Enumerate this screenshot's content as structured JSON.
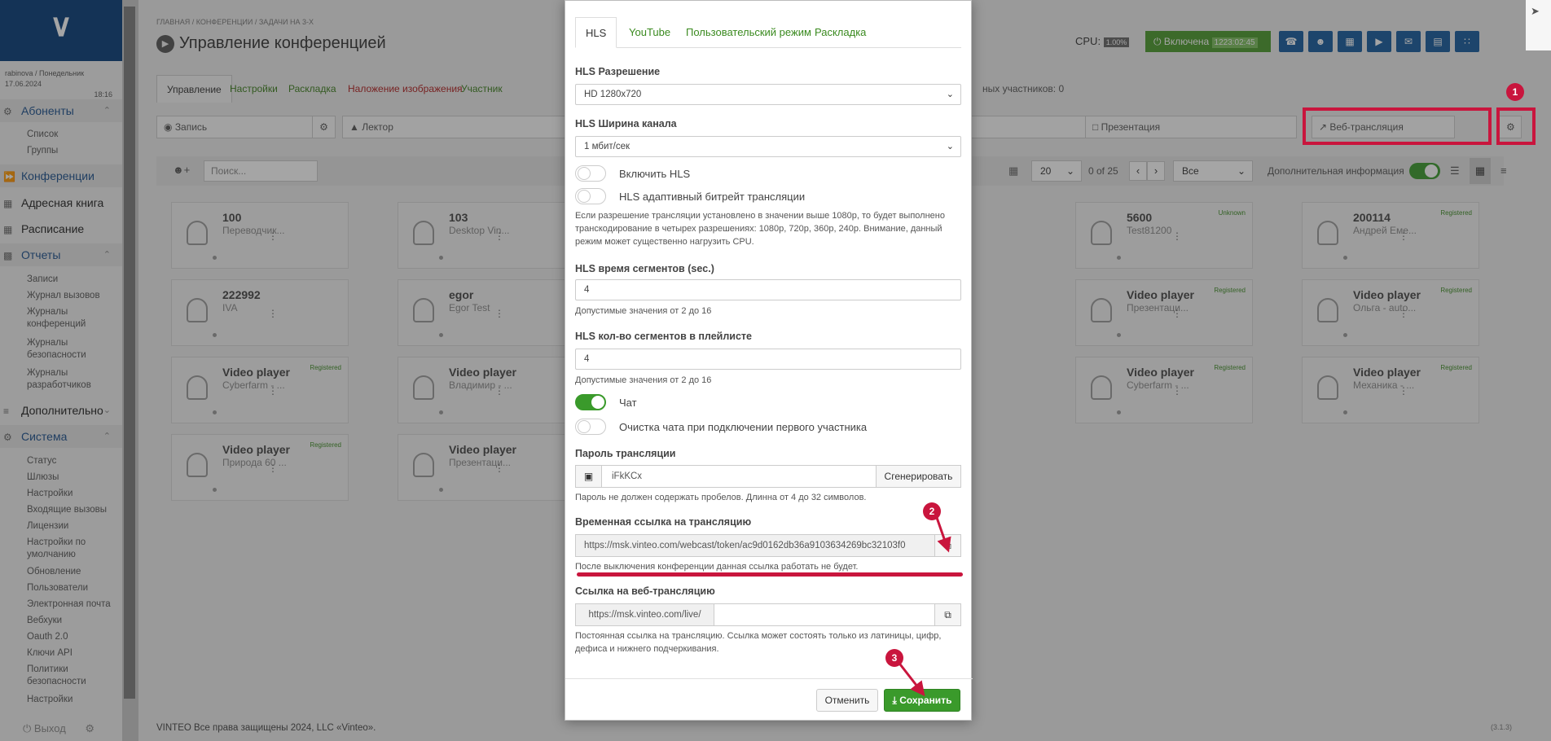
{
  "sidebar": {
    "logo": "∨",
    "user": "rabinova / Понедельник 17.06.2024",
    "time": "18:16",
    "sections": [
      {
        "label": "Абоненты",
        "items": [
          "Список",
          "Группы"
        ]
      },
      {
        "label": "Конференции"
      },
      {
        "label": "Адресная книга"
      },
      {
        "label": "Расписание"
      },
      {
        "label": "Отчеты",
        "items": [
          "Записи",
          "Журнал вызовов",
          "Журналы конференций",
          "Журналы безопасности",
          "Журналы разработчиков"
        ]
      },
      {
        "label": "Дополнительно"
      },
      {
        "label": "Система",
        "items": [
          "Статус",
          "Шлюзы",
          "Настройки",
          "Входящие вызовы",
          "Лицензии",
          "Настройки по умолчанию",
          "Обновление",
          "Пользователи",
          "Электронная почта",
          "Вебхуки",
          "Oauth 2.0",
          "Ключи API",
          "Политики безопасности",
          "Настройки"
        ]
      }
    ],
    "exit": "Выход"
  },
  "main": {
    "breadcrumb": "Главная / Конференции / Задачи на 3-х",
    "title": "Управление конференцией",
    "cpu_label": "CPU:",
    "cpu_value": "1.00%",
    "state_label": "Включена",
    "state_timer": "1223:02:45",
    "tabs": [
      "Управление",
      "Настройки",
      "Раскладка",
      "Наложение изображения",
      "Участник"
    ],
    "participants_info": "ных участников: 0",
    "record_label": "Запись",
    "lector_label": "Лектор",
    "presentation_label": "Презентация",
    "webcast_label": "Веб-трансляция",
    "search_placeholder": "Поиск...",
    "per_page": "20",
    "pager": "0 of 25",
    "filter": "Все",
    "extra_info": "Дополнительная информация",
    "footer": "VINTEO   Все права защищены 2024, LLC «Vinteo».",
    "version": "(3.1.3)",
    "cards": [
      {
        "name": "100",
        "sub": "Переводчик...",
        "status": ""
      },
      {
        "name": "103",
        "sub": "Desktop Vin...",
        "status": ""
      },
      {
        "name": "5600",
        "sub": "Test81200",
        "status": "Unknown"
      },
      {
        "name": "200114",
        "sub": "Андрей Еме...",
        "status": "Registered"
      },
      {
        "name": "222992",
        "sub": "IVA",
        "status": ""
      },
      {
        "name": "egor",
        "sub": "Egor Test",
        "status": ""
      },
      {
        "name": "Video player",
        "sub": "Презентаци...",
        "status": "Registered"
      },
      {
        "name": "Video player",
        "sub": "Ольга - auto...",
        "status": "Registered"
      },
      {
        "name": "Video player",
        "sub": "Cyberfarm - ...",
        "status": "Registered"
      },
      {
        "name": "Video player",
        "sub": "Владимир - ...",
        "status": ""
      },
      {
        "name": "Video player",
        "sub": "Cyberfarm - ...",
        "status": "Registered"
      },
      {
        "name": "Video player",
        "sub": "Механика - ...",
        "status": "Registered"
      },
      {
        "name": "Video player",
        "sub": "Природа 60 ...",
        "status": "Registered"
      },
      {
        "name": "Video player",
        "sub": "Презентаци...",
        "status": ""
      }
    ]
  },
  "modal": {
    "tabs": [
      "HLS",
      "YouTube",
      "Пользовательский режим",
      "Раскладка"
    ],
    "hls_resolution_label": "HLS Разрешение",
    "hls_resolution_value": "HD 1280x720",
    "hls_bandwidth_label": "HLS Ширина канала",
    "hls_bandwidth_value": "1 мбит/сек",
    "enable_hls_label": "Включить HLS",
    "adaptive_label": "HLS адаптивный битрейт трансляции",
    "adaptive_help": "Если разрешение трансляции установлено в значении выше 1080p, то будет выполнено транскодирование в четырех разрешениях: 1080p, 720p, 360p, 240p. Внимание, данный режим может существенно нагрузить CPU.",
    "segment_time_label": "HLS время сегментов (sec.)",
    "segment_time_value": "4",
    "segment_time_help": "Допустимые значения от 2 до 16",
    "segment_count_label": "HLS кол-во сегментов в плейлисте",
    "segment_count_value": "4",
    "segment_count_help": "Допустимые значения от 2 до 16",
    "chat_label": "Чат",
    "clear_chat_label": "Очистка чата при подключении первого участника",
    "password_label": "Пароль трансляции",
    "password_value": "iFkKCx",
    "generate_label": "Сгенерировать",
    "password_help": "Пароль не должен содержать пробелов. Длинна от 4 до 32 символов.",
    "temp_link_label": "Временная ссылка на трансляцию",
    "temp_link_value": "https://msk.vinteo.com/webcast/token/ac9d0162db36a9103634269bc32103f0",
    "temp_link_help": "После выключения конференции данная ссылка работать не будет.",
    "webcast_link_label": "Ссылка на веб-трансляцию",
    "webcast_link_prefix": "https://msk.vinteo.com/live/",
    "webcast_link_help": "Постоянная ссылка на трансляцию. Ссылка может состоять только из латиницы, цифр, дефиса и нижнего подчеркивания.",
    "cancel_label": "Отменить",
    "save_label": "Сохранить"
  },
  "annotations": {
    "badge1": "1",
    "badge2": "2",
    "badge3": "3",
    "color": "#c9153d"
  }
}
